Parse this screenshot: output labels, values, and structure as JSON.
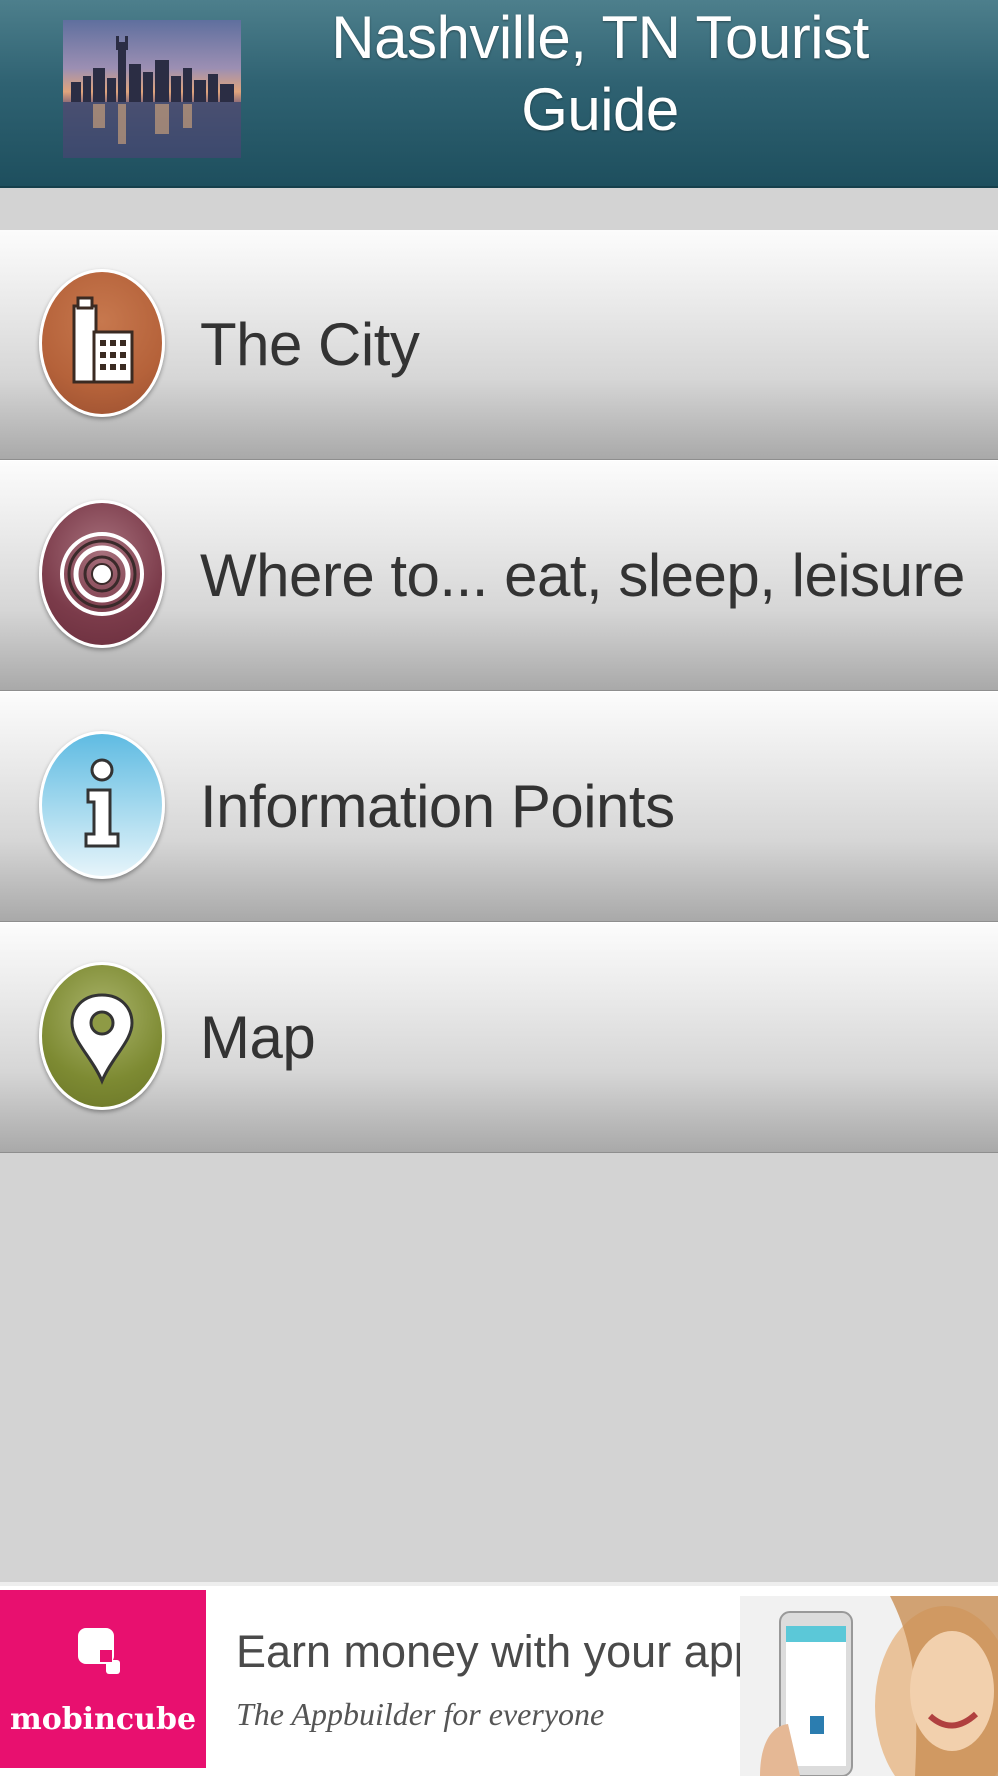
{
  "header": {
    "title": "Nashville, TN Tourist Guide",
    "photo_icon": "city-skyline-photo"
  },
  "menu": {
    "items": [
      {
        "label": "The City",
        "icon": "building-icon",
        "color": "#b5623a"
      },
      {
        "label": "Where to... eat, sleep, leisure",
        "icon": "target-icon",
        "color": "#7b3b4a"
      },
      {
        "label": "Information Points",
        "icon": "info-icon",
        "color": "#6cbfe3"
      },
      {
        "label": "Map",
        "icon": "map-pin-icon",
        "color": "#7d8a32"
      }
    ]
  },
  "ad": {
    "brand": "mobincube",
    "headline": "Earn money with your apps",
    "tagline": "The Appbuilder for everyone",
    "brand_color": "#e8106f"
  }
}
